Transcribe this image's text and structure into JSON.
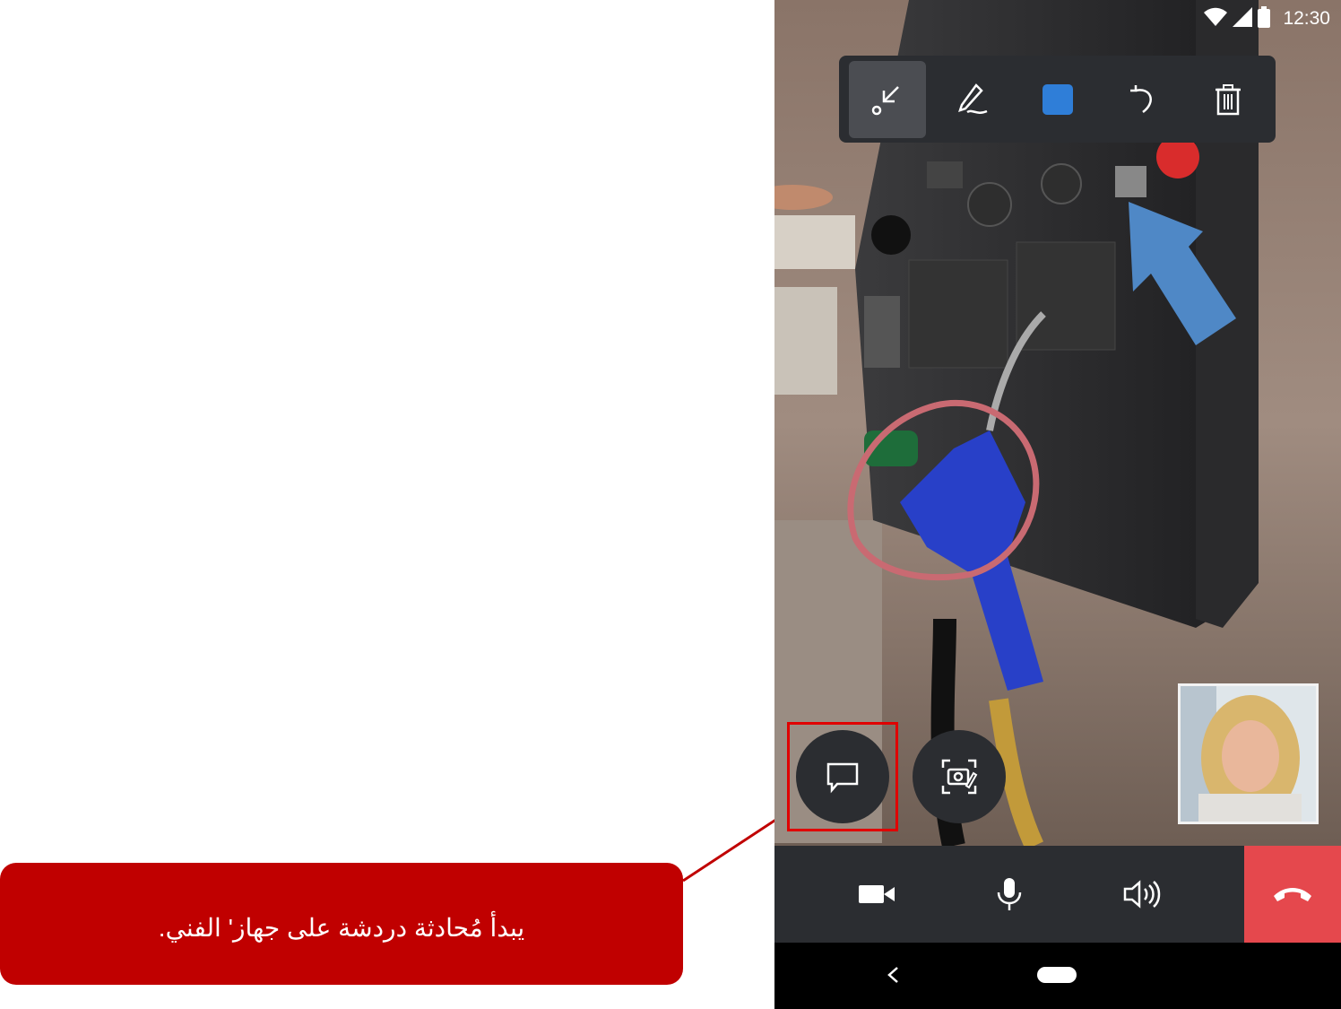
{
  "callout": {
    "text": "يبدأ مُحادثة دردشة على جهاز' الفني."
  },
  "status_bar": {
    "time": "12:30",
    "icons": [
      "wifi-icon",
      "cellular-signal-icon",
      "battery-icon"
    ]
  },
  "annotation_toolbar": {
    "tools": [
      "arrow-tool-icon",
      "pen-tool-icon",
      "color-picker",
      "undo-icon",
      "delete-icon"
    ],
    "selected_tool": "arrow-tool-icon",
    "selected_color": "#2f7ed8"
  },
  "action_buttons": [
    "chat-icon",
    "snapshot-icon"
  ],
  "call_controls": [
    "video-camera-icon",
    "microphone-icon",
    "speaker-icon",
    "end-call-icon"
  ],
  "colors": {
    "callout_bg": "#c00000",
    "highlight_border": "#e00000",
    "end_call": "#e5484d",
    "panel": "#2b2d31",
    "annotation_circle": "#c96a72",
    "annotation_arrow": "#4f88c6"
  },
  "nav_bar": [
    "back-icon",
    "home-pill"
  ]
}
